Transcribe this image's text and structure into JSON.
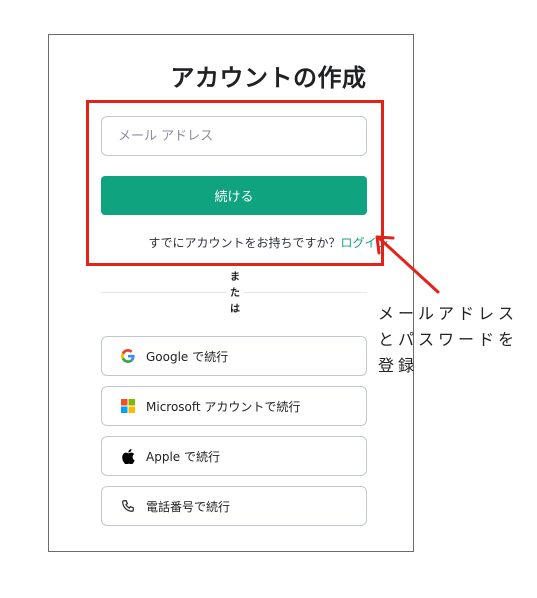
{
  "form": {
    "title": "アカウントの作成",
    "email_placeholder": "メール アドレス",
    "continue_label": "続ける",
    "login_prompt": "すでにアカウントをお持ちですか？",
    "login_link": "ログイン",
    "or_chars": [
      "ま",
      "た",
      "は"
    ]
  },
  "social": [
    {
      "label": "Google で続行",
      "icon": "google-icon"
    },
    {
      "label": "Microsoft アカウントで続行",
      "icon": "microsoft-icon"
    },
    {
      "label": "Apple で続行",
      "icon": "apple-icon"
    },
    {
      "label": "電話番号で続行",
      "icon": "phone-icon"
    }
  ],
  "annotation": {
    "lines": [
      "メールアドレス",
      "とパスワードを",
      "登録"
    ],
    "color": "#e2231a"
  },
  "colors": {
    "accent": "#10a37f",
    "highlight": "#e2231a"
  }
}
